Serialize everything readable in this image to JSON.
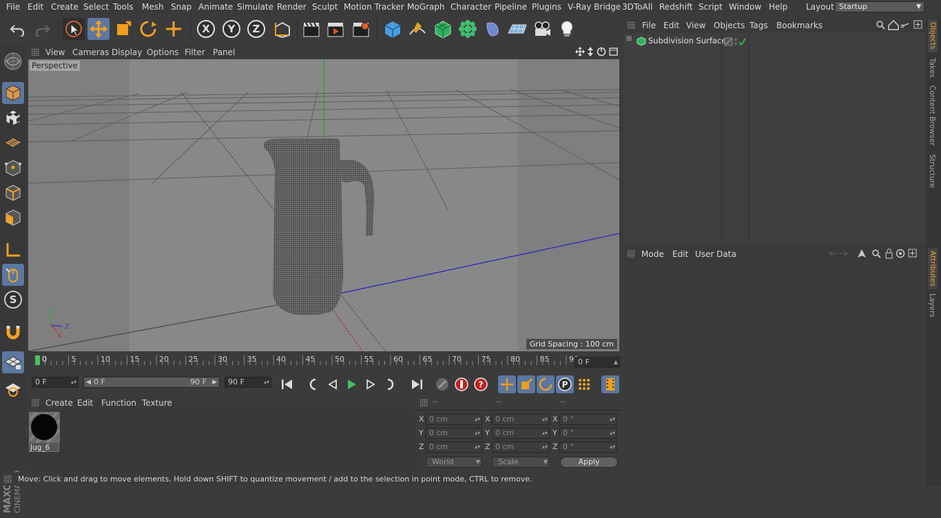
{
  "menubar": {
    "items": [
      "File",
      "Edit",
      "Create",
      "Select",
      "Tools",
      "Mesh",
      "Snap",
      "Animate",
      "Simulate",
      "Render",
      "Sculpt",
      "Motion Tracker",
      "MoGraph",
      "Character",
      "Pipeline",
      "Plugins",
      "V-Ray Bridge",
      "3DToAll",
      "Redshift",
      "Script",
      "Window",
      "Help"
    ],
    "layout_label": "Layout:",
    "layout_value": "Startup"
  },
  "viewport": {
    "menu": [
      "View",
      "Cameras",
      "Display",
      "Options",
      "Filter",
      "Panel"
    ],
    "camera_label": "Perspective",
    "grid_spacing": "Grid Spacing : 100 cm",
    "axis_labels": {
      "x": "X",
      "y": "Y",
      "z": "Z"
    }
  },
  "timeline": {
    "ticks": [
      "0",
      "5",
      "10",
      "15",
      "20",
      "25",
      "30",
      "35",
      "40",
      "45",
      "50",
      "55",
      "60",
      "65",
      "70",
      "75",
      "80",
      "85",
      "90"
    ],
    "current_frame": "0 F"
  },
  "transport": {
    "start_frame": "0 F",
    "range_start": "0 F",
    "range_end": "90 F",
    "end_frame": "90 F"
  },
  "material_manager": {
    "menu": [
      "Create",
      "Edit",
      "Function",
      "Texture"
    ],
    "materials": [
      {
        "name": "Jug_6"
      }
    ]
  },
  "coordinates": {
    "headers": [
      "--",
      "--",
      "--"
    ],
    "rows": [
      {
        "axis": "X",
        "pos": "0 cm",
        "size": "0 cm",
        "rot": "0 °"
      },
      {
        "axis": "Y",
        "pos": "0 cm",
        "size": "0 cm",
        "rot": "0 °"
      },
      {
        "axis": "Z",
        "pos": "0 cm",
        "size": "0 cm",
        "rot": "0 °"
      }
    ],
    "space": "World",
    "mode": "Scale",
    "apply": "Apply"
  },
  "status": "Move: Click and drag to move elements. Hold down SHIFT to quantize movement / add to the selection in point mode, CTRL to remove.",
  "object_manager": {
    "menu": [
      "File",
      "Edit",
      "View",
      "Objects",
      "Tags",
      "Bookmarks"
    ],
    "objects": [
      {
        "name": "Subdivision Surface"
      }
    ]
  },
  "attributes": {
    "menu": [
      "Mode",
      "Edit",
      "User Data"
    ]
  },
  "side_tabs": [
    "Objects",
    "Takes",
    "Content Browser",
    "Structure"
  ],
  "side_tabs_lower": [
    "Attributes",
    "Layers"
  ],
  "brand": {
    "maker": "MAXON",
    "product": "CINEMA 4D"
  },
  "colors": {
    "accent": "#5c77a0",
    "active_tab": "#e8a040",
    "playhead": "#4ac05a"
  }
}
